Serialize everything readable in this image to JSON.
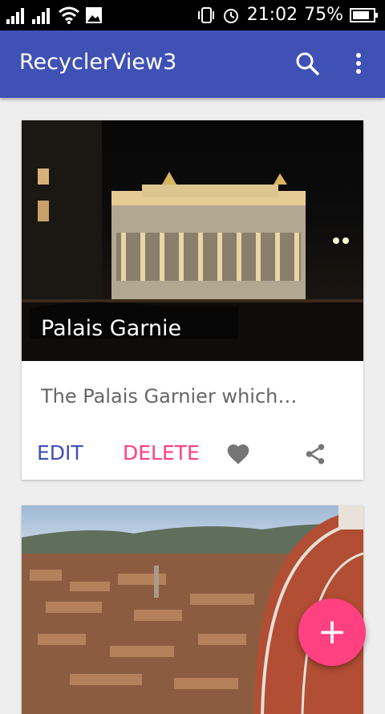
{
  "status_bar": {
    "time": "21:02",
    "battery_percent": "75%"
  },
  "appbar": {
    "title": "RecyclerView3"
  },
  "cards": [
    {
      "title": "Palais Garnie",
      "description": "The Palais Garnier which…",
      "edit_label": "EDIT",
      "delete_label": "DELETE"
    },
    {
      "title": ""
    }
  ],
  "fab": {
    "label": "+"
  },
  "colors": {
    "primary": "#3f51b5",
    "accent": "#ff4081"
  }
}
